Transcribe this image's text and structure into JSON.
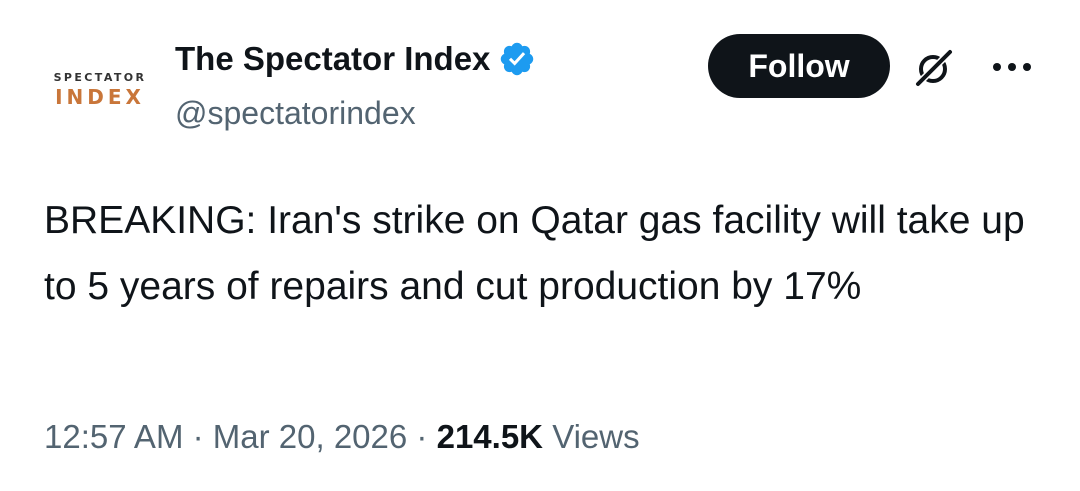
{
  "author": {
    "avatar_line1": "SPECTATOR",
    "avatar_line2": "INDEX",
    "display_name": "The Spectator Index",
    "handle": "@spectatorindex",
    "verified_color": "#1d9bf0"
  },
  "actions": {
    "follow_label": "Follow",
    "grok_icon": "grok-icon",
    "more_icon": "more-options-icon"
  },
  "tweet": {
    "text": "BREAKING: Iran's strike on Qatar gas facility will take up to 5 years of repairs and cut production by 17%"
  },
  "meta": {
    "time": "12:57 AM",
    "separator": "·",
    "date": "Mar 20, 2026",
    "views_count": "214.5K",
    "views_label": "Views"
  },
  "colors": {
    "text_primary": "#0f1419",
    "text_secondary": "#536471",
    "follow_bg": "#0f1419",
    "brand_orange": "#c9763a"
  }
}
